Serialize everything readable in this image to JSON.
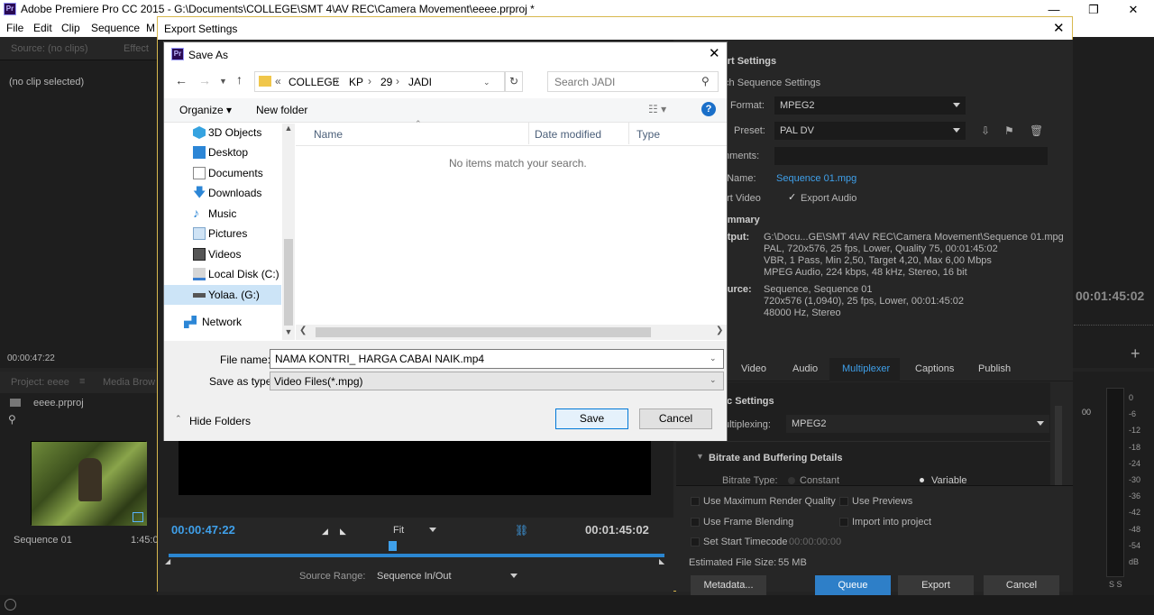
{
  "app": {
    "title": "Adobe Premiere Pro CC 2015 - G:\\Documents\\COLLEGE\\SMT 4\\AV REC\\Camera Movement\\eeee.prproj *",
    "icon": "Pr"
  },
  "menu": [
    "File",
    "Edit",
    "Clip",
    "Sequence",
    "M"
  ],
  "source_panel": {
    "tab_source": "Source: (no clips)",
    "tab_effect": "Effect",
    "status": "(no clip selected)",
    "timecode": "00:00:47:22"
  },
  "project_panel": {
    "tab": "Project: eeee",
    "tab_media": "Media Brow",
    "file": "eeee.prproj",
    "clip_name": "Sequence 01",
    "clip_duration": "1:45:0"
  },
  "program": {
    "timecode_right": "00:01:45:02",
    "ruler_fragment": "00"
  },
  "export": {
    "title": "Export Settings",
    "section": "ort Settings",
    "match": "tch Sequence Settings",
    "format_label": "Format:",
    "format_value": "MPEG2",
    "preset_label": "Preset:",
    "preset_value": "PAL DV",
    "comments_label": "mments:",
    "output_label": "t Name:",
    "output_value": "Sequence 01.mpg",
    "export_video": "ort Video",
    "export_audio": "Export Audio",
    "summary": "ummary",
    "out_label": "utput:",
    "out_lines": [
      "G:\\Docu...GE\\SMT 4\\AV REC\\Camera Movement\\Sequence 01.mpg",
      "PAL, 720x576, 25 fps, Lower, Quality 75, 00:01:45:02",
      "VBR, 1 Pass, Min 2,50, Target 4,20, Max 6,00 Mbps",
      "MPEG Audio, 224 kbps, 48 kHz, Stereo, 16 bit"
    ],
    "src_label": "ource:",
    "src_lines": [
      "Sequence, Sequence 01",
      "720x576 (1,0940), 25 fps, Lower, 00:01:45:02",
      "48000 Hz, Stereo"
    ],
    "tabs": [
      "Video",
      "Audio",
      "Multiplexer",
      "Captions",
      "Publish"
    ],
    "basic": "ic Settings",
    "mux_label": "ultiplexing:",
    "mux_value": "MPEG2",
    "bitrate_header": "Bitrate and Buffering Details",
    "bitrate_type": "Bitrate Type:",
    "constant": "Constant",
    "variable": "Variable",
    "max_render": "Use Maximum Render Quality",
    "previews": "Use Previews",
    "frame_blend": "Use Frame Blending",
    "import": "Import into project",
    "start_tc": "Set Start Timecode",
    "start_tc_value": "00:00:00:00",
    "est_size": "Estimated File Size:",
    "est_value": "55 MB",
    "metadata": "Metadata...",
    "queue": "Queue",
    "export": "Export",
    "cancel": "Cancel",
    "tc_in": "00:00:47:22",
    "fit": "Fit",
    "tc_dur": "00:01:45:02",
    "source_range_label": "Source Range:",
    "source_range_value": "Sequence In/Out",
    "right_tc": "00:01:45:02",
    "meter_ticks": [
      "0",
      "-6",
      "-12",
      "-18",
      "-24",
      "-30",
      "-36",
      "-42",
      "-48",
      "-54"
    ],
    "meter_db": "dB",
    "meter_ss": "S S"
  },
  "saveas": {
    "title": "Save As",
    "path": [
      "COLLEGE",
      "KP",
      "29",
      "JADI"
    ],
    "search_placeholder": "Search JADI",
    "organize": "Organize",
    "new_folder": "New folder",
    "tree": [
      "3D Objects",
      "Desktop",
      "Documents",
      "Downloads",
      "Music",
      "Pictures",
      "Videos",
      "Local Disk (C:)",
      "Yolaa. (G:)",
      "Network"
    ],
    "col_name": "Name",
    "col_date": "Date modified",
    "col_type": "Type",
    "empty": "No items match your search.",
    "file_name_label": "File name:",
    "file_name_value": "NAMA KONTRI_ HARGA CABAI NAIK.mp4",
    "save_type_label": "Save as type:",
    "save_type_value": "Video Files(*.mpg)",
    "hide_folders": "Hide Folders",
    "save": "Save",
    "cancel": "Cancel"
  },
  "colors": {
    "accent": "#3fa0ea",
    "border_gold": "#d8b84e"
  }
}
